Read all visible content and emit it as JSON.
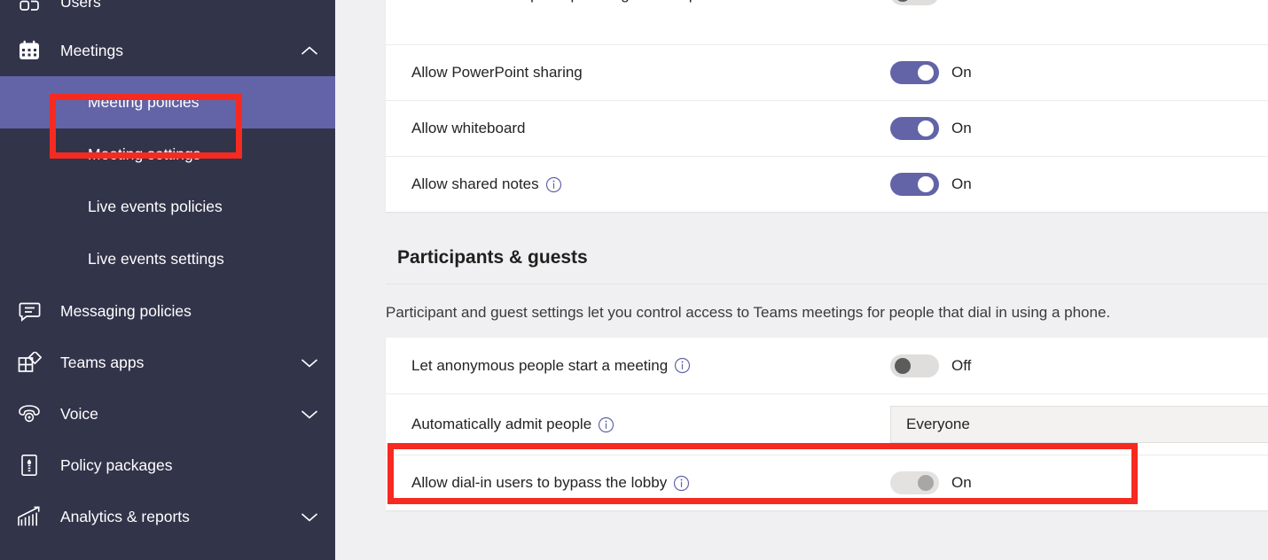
{
  "sidebar": {
    "items": [
      {
        "label": "Users",
        "icon": "users-icon",
        "chevron": "",
        "type": "nav"
      },
      {
        "label": "Meetings",
        "icon": "calendar-icon",
        "chevron": "chevron-up-icon",
        "type": "nav"
      },
      {
        "label": "Meeting policies",
        "type": "sub",
        "selected": true
      },
      {
        "label": "Meeting settings",
        "type": "sub",
        "selected": false
      },
      {
        "label": "Live events policies",
        "type": "sub",
        "selected": false
      },
      {
        "label": "Live events settings",
        "type": "sub",
        "selected": false
      },
      {
        "label": "Messaging policies",
        "icon": "message-icon",
        "chevron": "",
        "type": "nav"
      },
      {
        "label": "Teams apps",
        "icon": "apps-icon",
        "chevron": "chevron-down-icon",
        "type": "nav"
      },
      {
        "label": "Voice",
        "icon": "phone-icon",
        "chevron": "chevron-down-icon",
        "type": "nav"
      },
      {
        "label": "Policy packages",
        "icon": "policy-package-icon",
        "chevron": "",
        "type": "nav"
      },
      {
        "label": "Analytics & reports",
        "icon": "analytics-icon",
        "chevron": "chevron-down-icon",
        "type": "nav"
      }
    ]
  },
  "content": {
    "top_card_rows": [
      {
        "label": "Allow an external participant to give or request control",
        "control": "toggle",
        "state": "Off",
        "info": false
      },
      {
        "label": "Allow PowerPoint sharing",
        "control": "toggle",
        "state": "On",
        "info": false
      },
      {
        "label": "Allow whiteboard",
        "control": "toggle",
        "state": "On",
        "info": false
      },
      {
        "label": "Allow shared notes",
        "control": "toggle",
        "state": "On",
        "info": true
      }
    ],
    "section": {
      "title": "Participants & guests",
      "description": "Participant and guest settings let you control access to Teams meetings for people that dial in using a phone.",
      "rows": [
        {
          "label": "Let anonymous people start a meeting",
          "control": "toggle",
          "state": "Off",
          "info": true
        },
        {
          "label": "Automatically admit people",
          "control": "dropdown",
          "value": "Everyone",
          "info": true
        },
        {
          "label": "Allow dial-in users to bypass the lobby",
          "control": "toggle",
          "state": "On",
          "info": true,
          "disabled": true
        }
      ]
    }
  },
  "annotations": {
    "sidebar_highlight": "Meeting policies",
    "row_highlight": "Automatically admit people",
    "color": "#f62a20"
  },
  "colors": {
    "sidebar_bg": "#32344a",
    "selection": "#6264a7",
    "accent": "#6264a7",
    "page_bg": "#f0eff1",
    "card_bg": "#ffffff"
  }
}
